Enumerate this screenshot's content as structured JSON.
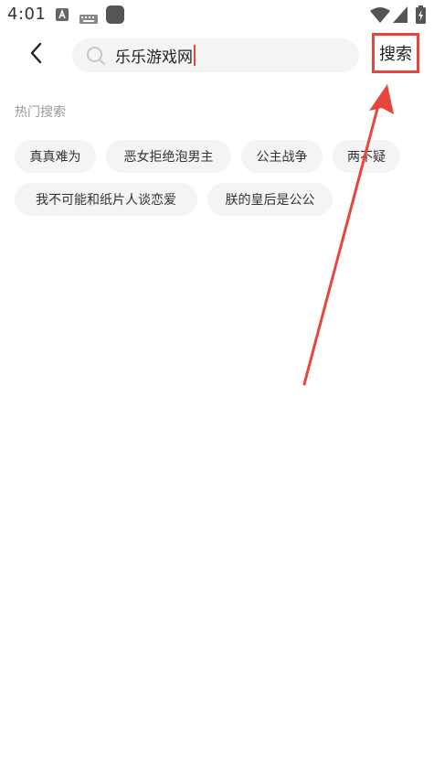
{
  "status_bar": {
    "time": "4:01"
  },
  "search": {
    "query": "乐乐游戏网",
    "button_label": "搜索"
  },
  "hot_search": {
    "title": "热门搜索",
    "tags": [
      "真真难为",
      "恶女拒绝泡男主",
      "公主战争",
      "两不疑",
      "我不可能和纸片人谈恋爱",
      "朕的皇后是公公"
    ]
  },
  "colors": {
    "accent": "#e8453c",
    "chip_bg": "#f4f4f4",
    "muted_text": "#9a9a9a"
  }
}
